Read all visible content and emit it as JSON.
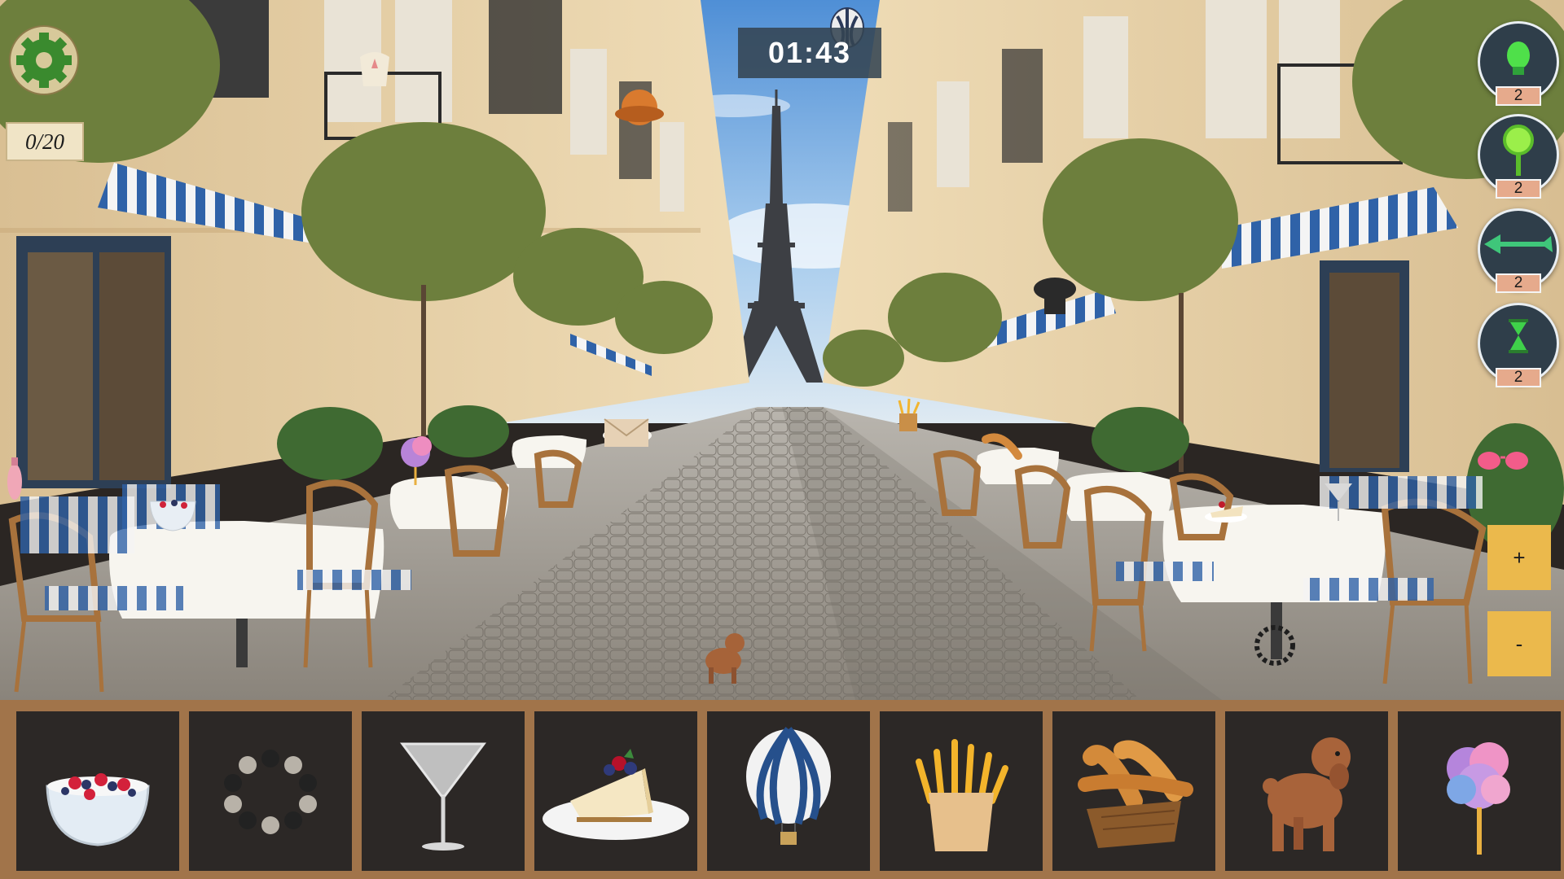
{
  "hud": {
    "found_counter": "0/20",
    "timer": "01:43",
    "settings_icon": "gear-icon"
  },
  "hints": [
    {
      "name": "lightbulb-hint",
      "icon": "lightbulb-icon",
      "count": "2"
    },
    {
      "name": "magnifier-hint",
      "icon": "magnifier-icon",
      "count": "2"
    },
    {
      "name": "arrow-hint",
      "icon": "arrow-icon",
      "count": "2"
    },
    {
      "name": "hourglass-hint",
      "icon": "hourglass-icon",
      "count": "2"
    }
  ],
  "zoom": {
    "in_label": "+",
    "out_label": "-"
  },
  "items_to_find": [
    {
      "icon": "berry-yogurt-bowl-icon"
    },
    {
      "icon": "bead-bracelet-icon"
    },
    {
      "icon": "martini-glass-icon"
    },
    {
      "icon": "cheesecake-slice-icon"
    },
    {
      "icon": "hot-air-balloon-icon"
    },
    {
      "icon": "french-fries-icon"
    },
    {
      "icon": "baguette-basket-icon"
    },
    {
      "icon": "poodle-dog-icon"
    },
    {
      "icon": "cotton-candy-icon"
    }
  ],
  "colors": {
    "item_bar_frame": "#a1744a",
    "item_slot": "#2c2826",
    "hint_count_badge": "#e6aa8c",
    "zoom_button": "#ebb94c",
    "timer_bg": "#344452"
  }
}
